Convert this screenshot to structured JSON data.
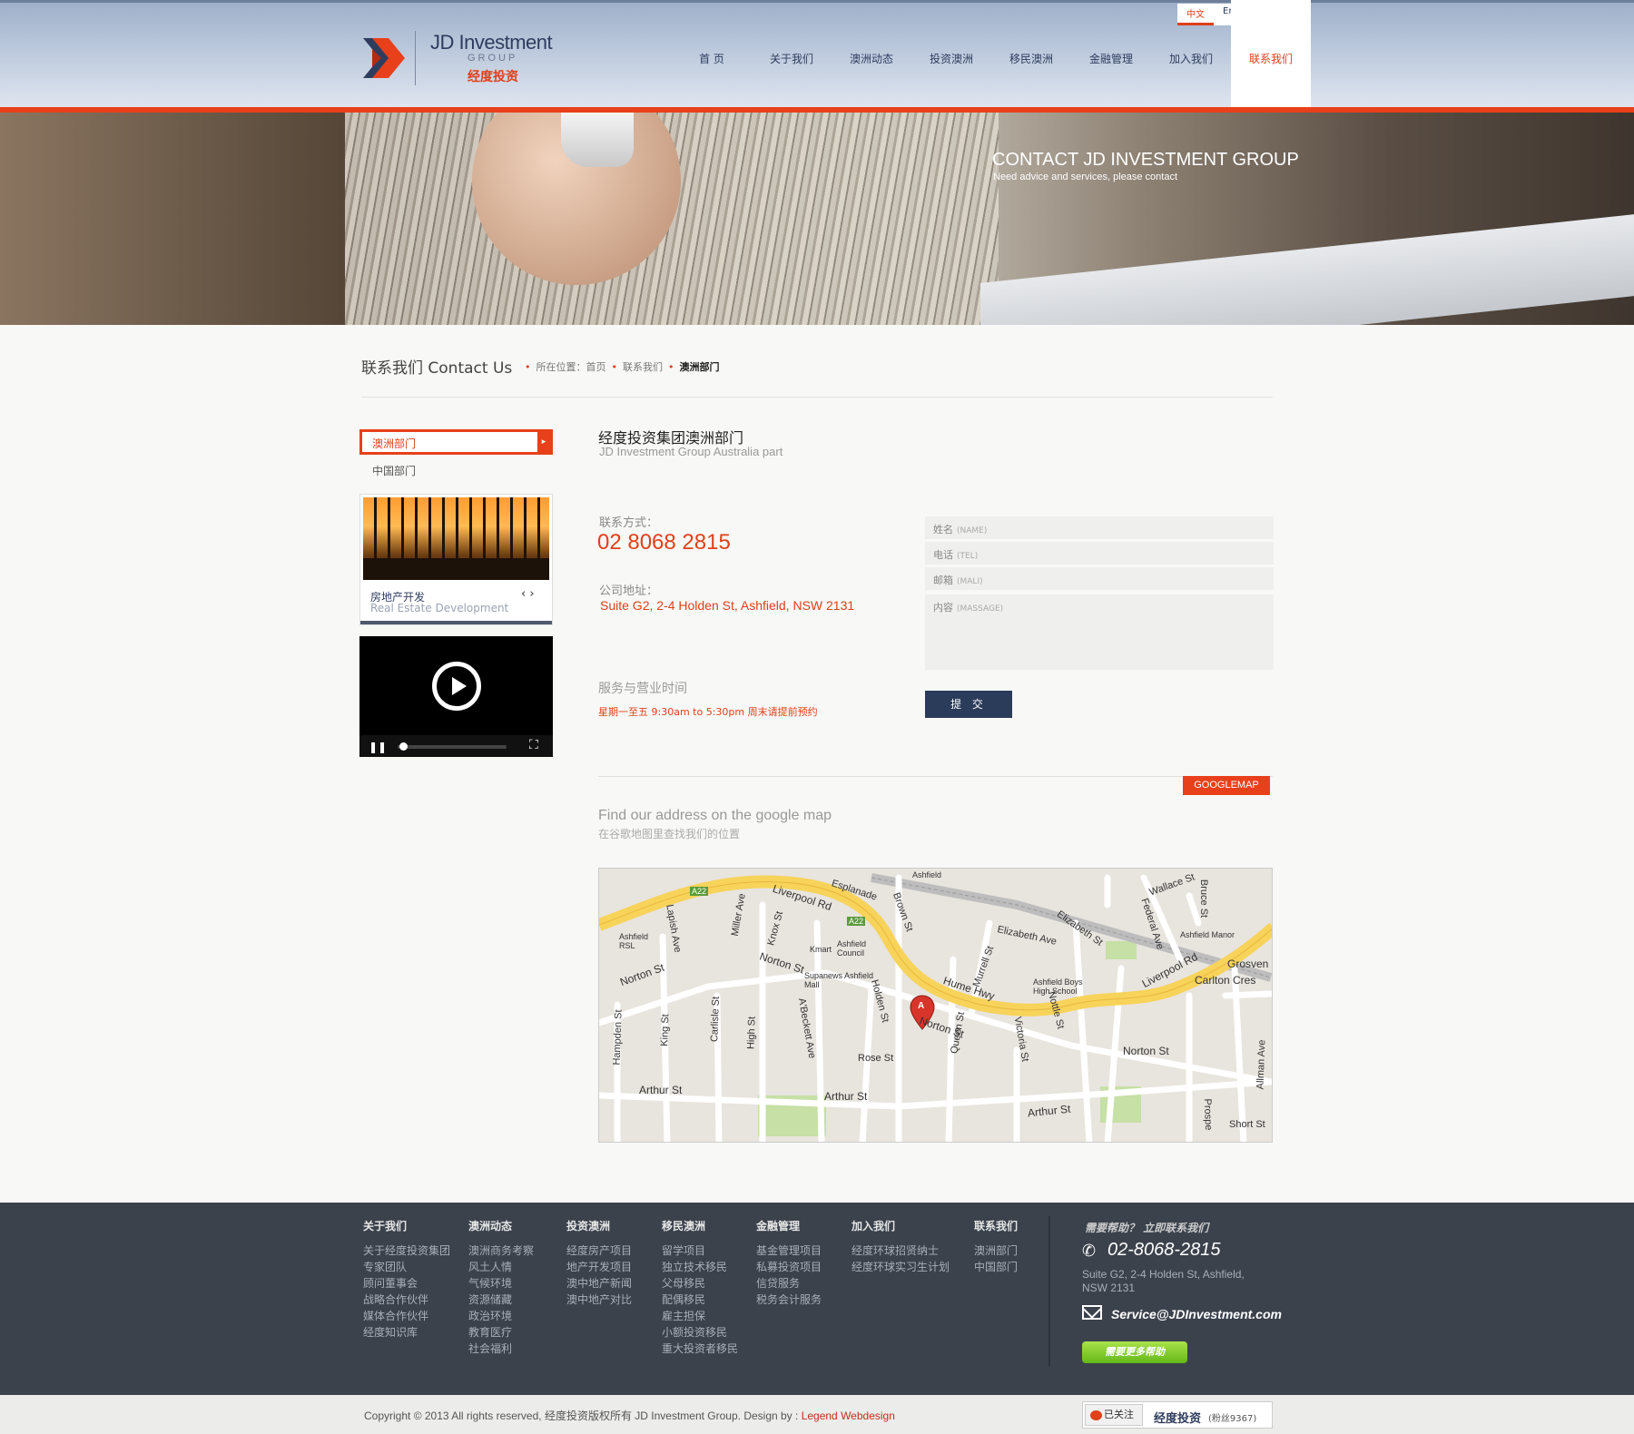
{
  "header": {
    "logo_en": "JD Investment",
    "logo_group": "GROUP",
    "logo_cn": "经度投资",
    "languages": [
      "中文",
      "English"
    ],
    "nav": [
      "首 页",
      "关于我们",
      "澳洲动态",
      "投资澳洲",
      "移民澳洲",
      "金融管理",
      "加入我们",
      "联系我们"
    ],
    "active_nav": "联系我们"
  },
  "banner": {
    "title": "CONTACT JD INVESTMENT GROUP",
    "subtitle": "Need advice and services, please contact"
  },
  "page": {
    "heading": "联系我们 Contact Us",
    "breadcrumb": [
      "所在位置：首页",
      "联系我们",
      "澳洲部门"
    ]
  },
  "sidebar": {
    "items": [
      "澳洲部门",
      "中国部门"
    ],
    "card_title": "房地产开发",
    "card_subtitle": "Real Estate Development"
  },
  "main": {
    "dept_title": "经度投资集团澳洲部门",
    "dept_subtitle": "JD Investment Group Australia part",
    "contact_label": "联系方式：",
    "phone": "02 8068 2815",
    "address_label": "公司地址：",
    "address": "Suite G2, 2-4 Holden St, Ashfield, NSW 2131",
    "hours_label": "服务与营业时间",
    "hours": "星期一至五 9:30am to 5:30pm 周末请提前预约"
  },
  "form": {
    "name_label": "姓名",
    "name_hint": "(NAME)",
    "tel_label": "电话",
    "tel_hint": "(TEL)",
    "mail_label": "邮箱",
    "mail_hint": "(MALI)",
    "content_label": "内容",
    "content_hint": "(MASSAGE)",
    "submit": "提 交"
  },
  "map_section": {
    "badge": "GOOGLEMAP",
    "title": "Find our address on the google map",
    "subtitle": "在谷歌地图里查找我们的位置",
    "labels": {
      "esplanade": "Esplanade",
      "ashfield_station": "Ashfield",
      "liverpool_rd": "Liverpool Rd",
      "liverpool_rd2": "Liverpool Rd",
      "a22": "A22",
      "a22b": "A22",
      "wallace": "Wallace St",
      "bruce": "Bruce St",
      "elizabeth": "Elizabeth St",
      "elizabeth_ave": "Elizabeth Ave",
      "federal": "Federal Ave",
      "ashfield_manor": "Ashfield Manor",
      "grosvenor": "Grosven",
      "carlton": "Carlton Cres",
      "ashfield_rsl": "Ashfield RSL",
      "lapish": "Lapish Ave",
      "miller": "Miller Ave",
      "knox": "Knox St",
      "kmart": "Kmart",
      "council": "Ashfield Council",
      "brown": "Brown St",
      "supa": "Supanews Ashfield Mall",
      "murrell": "Murrell St",
      "boys_high": "Ashfield Boys High School",
      "hume": "Hume Hwy",
      "norton1": "Norton St",
      "norton2": "Norton St",
      "norton3": "Norton St",
      "norton4": "Norton St",
      "king": "King St",
      "carlisle": "Carlisle St",
      "high": "High St",
      "abeckett": "A'Beckett Ave",
      "holden": "Holden St",
      "rose": "Rose St",
      "queen": "Queen St",
      "victoria": "Victoria St",
      "nottle": "Nottle St",
      "hampden": "Hampden St",
      "arthur1": "Arthur St",
      "arthur2": "Arthur St",
      "arthur3": "Arthur St",
      "allman": "Allman Ave",
      "prospect": "Prospe",
      "short": "Short St",
      "marker": "A"
    }
  },
  "footer": {
    "columns": [
      {
        "title": "关于我们",
        "items": [
          "关于经度投资集团",
          "专家团队",
          "顾问董事会",
          "战略合作伙伴",
          "媒体合作伙伴",
          "经度知识库"
        ]
      },
      {
        "title": "澳洲动态",
        "items": [
          "澳洲商务考察",
          "风土人情",
          "气候环境",
          "资源储藏",
          "政治环境",
          "教育医疗",
          "社会福利"
        ]
      },
      {
        "title": "投资澳洲",
        "items": [
          "经度房产项目",
          "地产开发项目",
          "澳中地产新闻",
          "澳中地产对比"
        ]
      },
      {
        "title": "移民澳洲",
        "items": [
          "留学项目",
          "独立技术移民",
          "父母移民",
          "配偶移民",
          "雇主担保",
          "小额投资移民",
          "重大投资者移民"
        ]
      },
      {
        "title": "金融管理",
        "items": [
          "基金管理项目",
          "私募投资项目",
          "信贷服务",
          "税务会计服务"
        ]
      },
      {
        "title": "加入我们",
        "items": [
          "经度环球招贤纳士",
          "经度环球实习生计划"
        ]
      },
      {
        "title": "联系我们",
        "items": [
          "澳洲部门",
          "中国部门"
        ]
      }
    ],
    "help_title": "需要帮助？ 立即联系我们",
    "help_phone": "02-8068-2815",
    "help_address": "Suite G2, 2-4 Holden St, Ashfield, NSW 2131",
    "help_email": "Service@JDInvestment.com",
    "help_button": "需要更多帮助",
    "copyright": "Copyright © 2013 All rights reserved,  经度投资版权所有 JD Investment Group.  Design by : ",
    "designer": "Legend Webdesign",
    "weibo_follow": "已关注",
    "weibo_name": "经度投资",
    "weibo_fans": "(粉丝9367)"
  },
  "colors": {
    "accent": "#e8401b",
    "navy": "#2e3d5e",
    "footer_bg": "#3b424c"
  }
}
